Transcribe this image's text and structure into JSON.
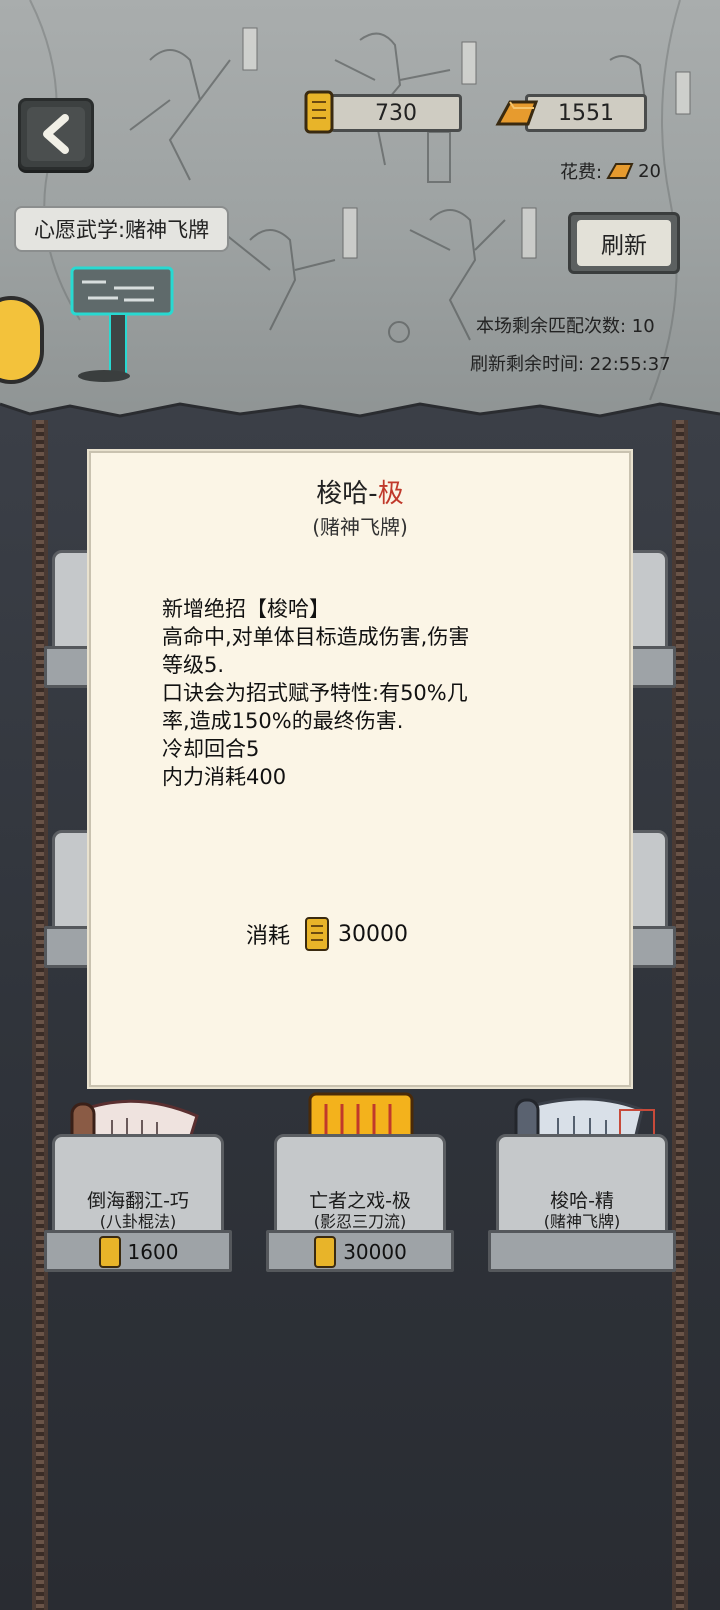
{
  "header": {
    "token_balance": "730",
    "gold_balance": "1551",
    "cost_label": "花费:",
    "cost_value": "20",
    "wish_label": "心愿武学:赌神飞牌",
    "refresh_label": "刷新",
    "remaining_matches": "本场剩余匹配次数: 10",
    "refresh_time": "刷新剩余时间: 22:55:37"
  },
  "modal": {
    "title": "梭哈-",
    "title_grade": "极",
    "subtitle": "(赌神飞牌)",
    "description": [
      "新增绝招【梭哈】",
      "高命中,对单体目标造成伤害,伤害",
      "等级5.",
      "口诀会为招式赋予特性:有50%几",
      "率,造成150%的最终伤害.",
      "冷却回合5",
      "内力消耗400"
    ],
    "cost_label": "消耗",
    "cost_value": "30000"
  },
  "shelf_items": [
    {
      "name": "倒海翻江-巧",
      "school": "(八卦棍法)",
      "price": "1600"
    },
    {
      "name": "亡者之戏-极",
      "school": "(影忍三刀流)",
      "price": "30000"
    },
    {
      "name": "梭哈-精",
      "school": "(赌神飞牌)",
      "price": ""
    }
  ],
  "colors": {
    "grade_red": "#c0392b",
    "modal_bg": "#fbf5e6",
    "avatar_yellow": "#f3c23b"
  },
  "icons": {
    "back": "chevron-left-icon",
    "token": "token-scroll-icon",
    "gold": "gold-bar-icon"
  }
}
